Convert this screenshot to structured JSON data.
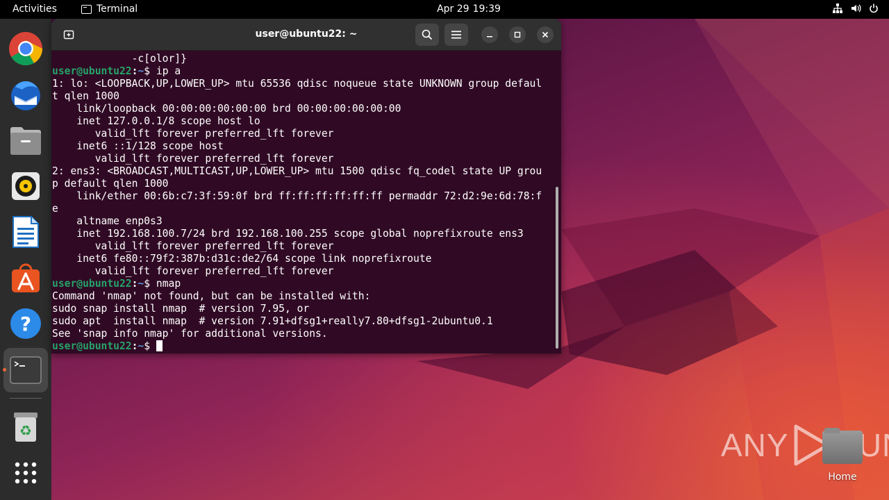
{
  "topbar": {
    "activities": "Activities",
    "app_name": "Terminal",
    "date": "Apr 29",
    "time": "19:39",
    "icons": [
      "network-icon",
      "volume-icon",
      "power-icon"
    ]
  },
  "dock": {
    "items": [
      {
        "name": "chrome",
        "icon": "chrome-icon"
      },
      {
        "name": "thunderbird",
        "icon": "thunderbird-icon"
      },
      {
        "name": "files",
        "icon": "files-icon"
      },
      {
        "name": "rhythmbox",
        "icon": "rhythmbox-icon"
      },
      {
        "name": "libreoffice-writer",
        "icon": "writer-icon"
      },
      {
        "name": "app-center",
        "icon": "app-center-icon"
      },
      {
        "name": "help",
        "icon": "help-icon"
      },
      {
        "name": "terminal",
        "icon": "terminal-icon",
        "running": true
      },
      {
        "name": "trash",
        "icon": "trash-icon"
      },
      {
        "name": "show-apps",
        "icon": "grid-icon"
      }
    ]
  },
  "terminal": {
    "title": "user@ubuntu22: ~",
    "lines": [
      {
        "type": "text",
        "text": "             -c[olor]}"
      },
      {
        "type": "prompt",
        "user": "user@ubuntu22",
        "sep": ":",
        "path": "~",
        "cmd": "$ ip a"
      },
      {
        "type": "text",
        "text": "1: lo: <LOOPBACK,UP,LOWER_UP> mtu 65536 qdisc noqueue state UNKNOWN group defaul"
      },
      {
        "type": "text",
        "text": "t qlen 1000"
      },
      {
        "type": "text",
        "text": "    link/loopback 00:00:00:00:00:00 brd 00:00:00:00:00:00"
      },
      {
        "type": "text",
        "text": "    inet 127.0.0.1/8 scope host lo"
      },
      {
        "type": "text",
        "text": "       valid_lft forever preferred_lft forever"
      },
      {
        "type": "text",
        "text": "    inet6 ::1/128 scope host"
      },
      {
        "type": "text",
        "text": "       valid_lft forever preferred_lft forever"
      },
      {
        "type": "text",
        "text": "2: ens3: <BROADCAST,MULTICAST,UP,LOWER_UP> mtu 1500 qdisc fq_codel state UP grou"
      },
      {
        "type": "text",
        "text": "p default qlen 1000"
      },
      {
        "type": "text",
        "text": "    link/ether 00:6b:c7:3f:59:0f brd ff:ff:ff:ff:ff:ff permaddr 72:d2:9e:6d:78:f"
      },
      {
        "type": "text",
        "text": "e"
      },
      {
        "type": "text",
        "text": "    altname enp0s3"
      },
      {
        "type": "text",
        "text": "    inet 192.168.100.7/24 brd 192.168.100.255 scope global noprefixroute ens3"
      },
      {
        "type": "text",
        "text": "       valid_lft forever preferred_lft forever"
      },
      {
        "type": "text",
        "text": "    inet6 fe80::79f2:387b:d31c:de2/64 scope link noprefixroute"
      },
      {
        "type": "text",
        "text": "       valid_lft forever preferred_lft forever"
      },
      {
        "type": "prompt",
        "user": "user@ubuntu22",
        "sep": ":",
        "path": "~",
        "cmd": "$ nmap"
      },
      {
        "type": "text",
        "text": "Command 'nmap' not found, but can be installed with:"
      },
      {
        "type": "text",
        "text": "sudo snap install nmap  # version 7.95, or"
      },
      {
        "type": "text",
        "text": "sudo apt  install nmap  # version 7.91+dfsg1+really7.80+dfsg1-2ubuntu0.1"
      },
      {
        "type": "text",
        "text": "See 'snap info nmap' for additional versions."
      },
      {
        "type": "prompt",
        "user": "user@ubuntu22",
        "sep": ":",
        "path": "~",
        "cmd": "$ ",
        "cursor": true
      }
    ]
  },
  "desktop": {
    "home_label": "Home",
    "watermark": {
      "left": "ANY",
      "right": "RUN"
    }
  },
  "colors": {
    "terminal_bg": "#300a24",
    "prompt_user": "#26a269",
    "prompt_path": "#5a93d9",
    "accent": "#e95420"
  }
}
